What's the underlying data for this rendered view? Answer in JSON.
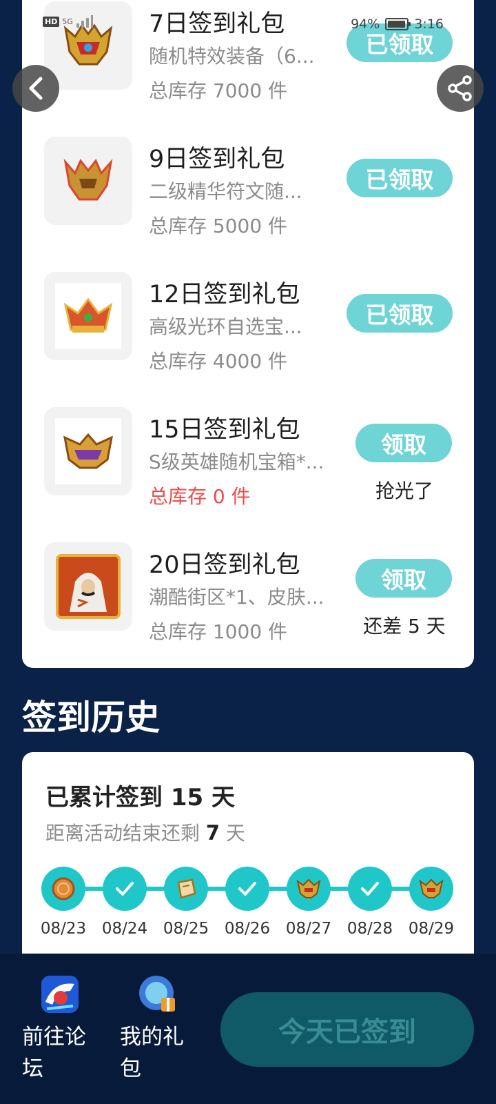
{
  "status_bar": {
    "hd": "HD",
    "network": "5G",
    "battery_percent": "94%",
    "battery_level": 0.94,
    "time": "3:16"
  },
  "gifts": [
    {
      "title": "7日签到礼包",
      "desc": "随机特效装备（6...",
      "stock": "总库存 7000 件",
      "button": "已领取",
      "note": ""
    },
    {
      "title": "9日签到礼包",
      "desc": "二级精华符文随...",
      "stock": "总库存 5000 件",
      "button": "已领取",
      "note": ""
    },
    {
      "title": "12日签到礼包",
      "desc": "高级光环自选宝...",
      "stock": "总库存 4000 件",
      "button": "已领取",
      "note": ""
    },
    {
      "title": "15日签到礼包",
      "desc": "S级英雄随机宝箱*...",
      "stock": "总库存 0 件",
      "button": "领取",
      "note": "抢光了"
    },
    {
      "title": "20日签到礼包",
      "desc": "潮酷街区*1、皮肤...",
      "stock": "总库存 1000 件",
      "button": "领取",
      "note": "还差 5 天"
    }
  ],
  "history": {
    "heading": "签到历史",
    "total_prefix": "已累计签到",
    "total_days": "15",
    "total_suffix": "天",
    "remain_prefix": "距离活动结束还剩",
    "remain_days": "7",
    "remain_suffix": "天",
    "timeline": [
      {
        "date": "08/23",
        "icon": "coin-icon"
      },
      {
        "date": "08/24",
        "icon": "check-icon"
      },
      {
        "date": "08/25",
        "icon": "scroll-icon"
      },
      {
        "date": "08/26",
        "icon": "check-icon"
      },
      {
        "date": "08/27",
        "icon": "helmet-icon"
      },
      {
        "date": "08/28",
        "icon": "check-icon"
      },
      {
        "date": "08/29",
        "icon": "helmet-icon"
      }
    ]
  },
  "bottom": {
    "forum_label": "前往论坛",
    "gifts_label": "我的礼包",
    "signin_label": "今天已签到"
  },
  "colors": {
    "background": "#0b2248",
    "accent": "#1fc7c9",
    "claim_button": "#6fd4d6",
    "stock_empty": "#ef4a4a"
  }
}
